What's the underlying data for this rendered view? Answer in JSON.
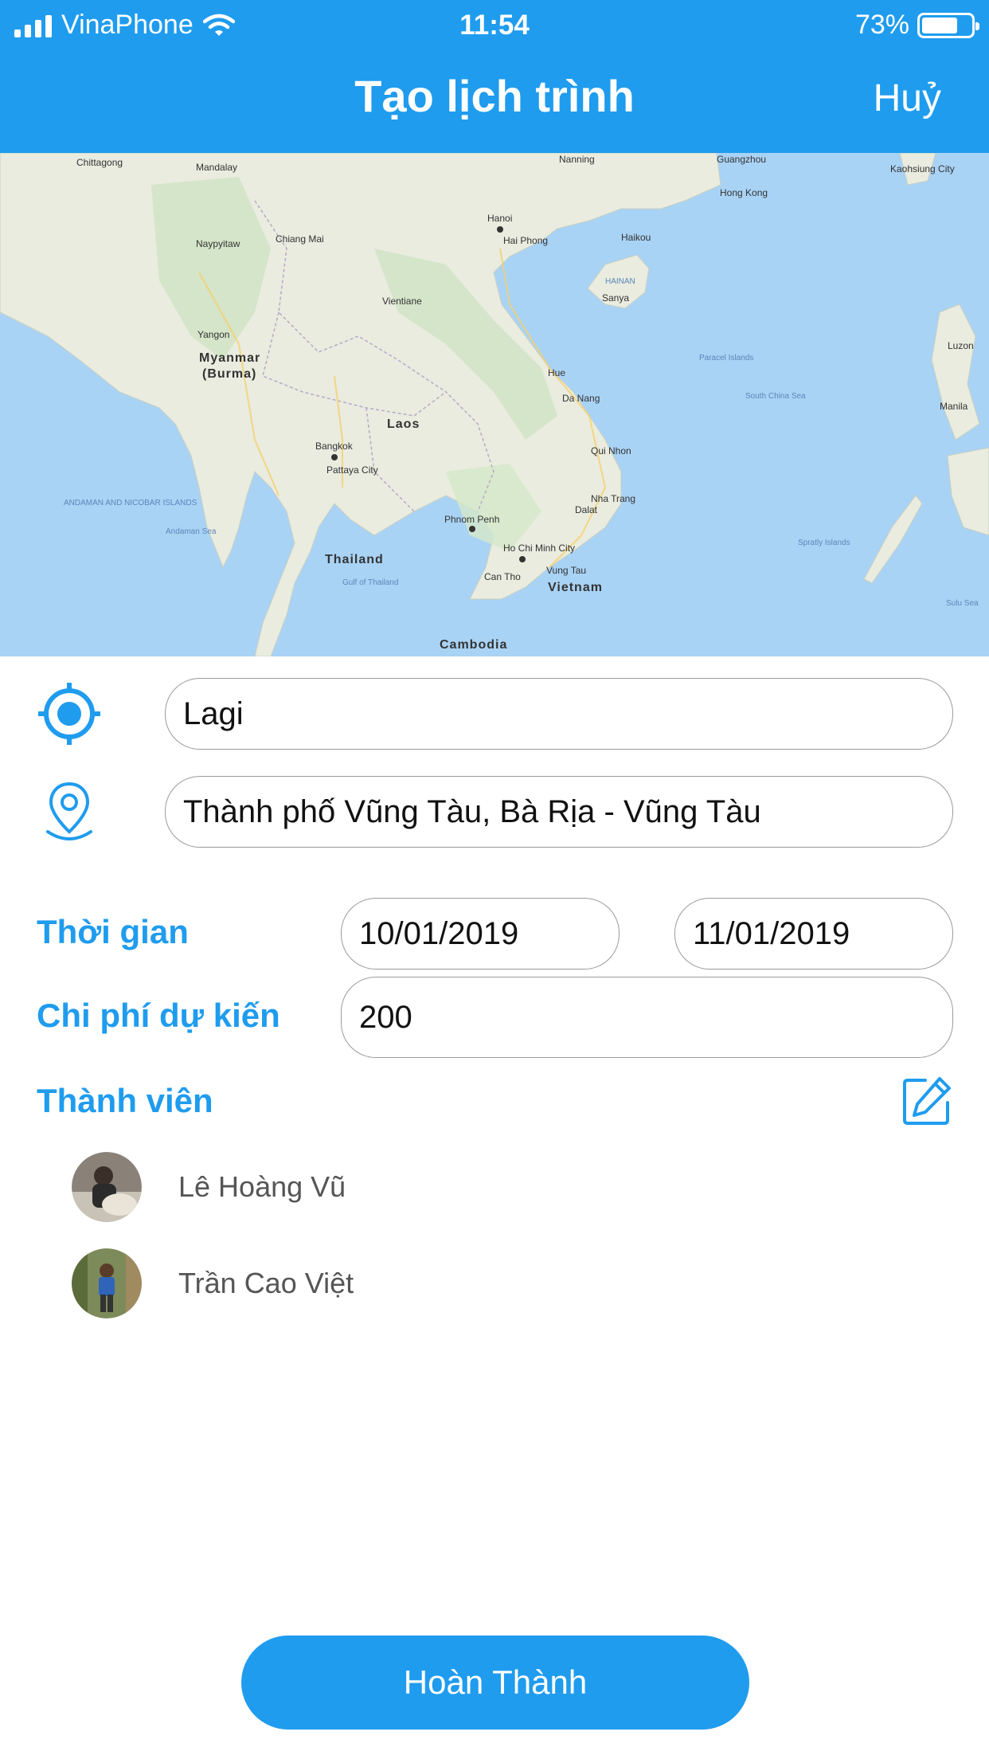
{
  "status_bar": {
    "carrier": "VinaPhone",
    "time": "11:54",
    "battery_percent": "73%",
    "battery_level": 0.73
  },
  "header": {
    "title": "Tạo lịch trình",
    "cancel_label": "Huỷ"
  },
  "map": {
    "countries": [
      "Myanmar",
      "(Burma)",
      "Laos",
      "Thailand",
      "Cambodia",
      "Vietnam"
    ],
    "cities": [
      "Mandalay",
      "Naypyitaw",
      "Yangon",
      "Chiang Mai",
      "Vientiane",
      "Hanoi",
      "Hai Phong",
      "Bangkok",
      "Pattaya City",
      "Phnom Penh",
      "Ho Chi Minh City",
      "Da Nang",
      "Hue",
      "Qui Nhon",
      "Nha Trang",
      "Dalat",
      "Vung Tau",
      "Can Tho",
      "Guangzhou",
      "Hong Kong",
      "Kaohsiung City",
      "Chittagong",
      "Nanning",
      "Sanya",
      "Haikou",
      "Manila",
      "Luzon"
    ],
    "regions": [
      "HAINAN",
      "ANDAMAN AND NICOBAR ISLANDS",
      "Andaman Sea",
      "South China Sea",
      "Gulf of Thailand",
      "Paracel Islands",
      "Spratly Islands",
      "Sulu Sea"
    ]
  },
  "form": {
    "origin_value": "Lagi",
    "destination_value": "Thành phố Vũng Tàu, Bà Rịa - Vũng Tàu",
    "time_label": "Thời gian",
    "start_date": "10/01/2019",
    "end_date": "11/01/2019",
    "cost_label": "Chi phí dự kiến",
    "cost_value": "200",
    "members_label": "Thành viên"
  },
  "members": [
    {
      "name": "Lê Hoàng Vũ"
    },
    {
      "name": "Trần Cao Việt"
    }
  ],
  "footer": {
    "done_label": "Hoàn Thành"
  },
  "colors": {
    "accent": "#1f9cee",
    "map_water": "#a9d3f5",
    "map_land": "#e9ecdf"
  }
}
